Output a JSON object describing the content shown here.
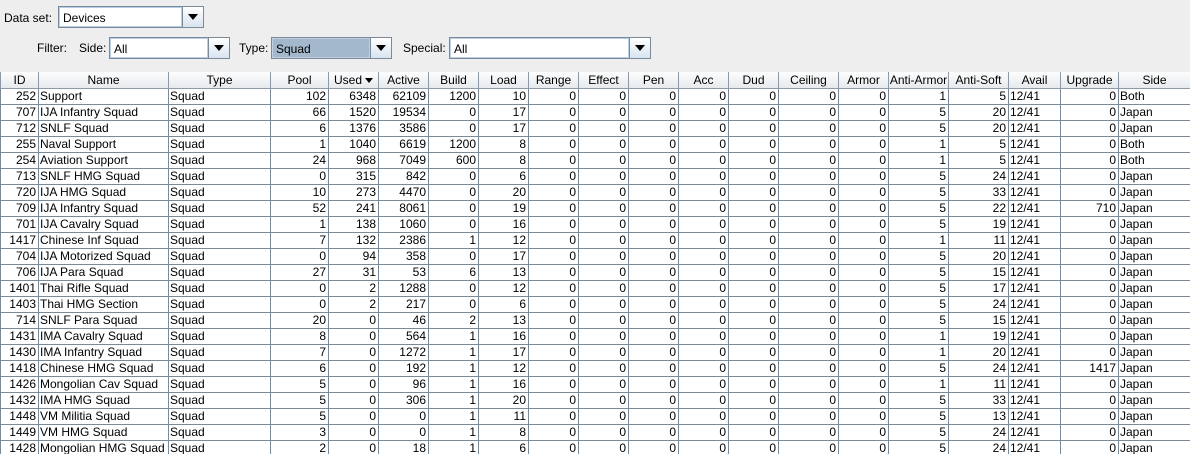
{
  "toolbar": {
    "dataset_label": "Data set:",
    "dataset_value": "Devices",
    "filter_label": "Filter:",
    "side_label": "Side:",
    "side_value": "All",
    "type_label": "Type:",
    "type_value": "Squad",
    "special_label": "Special:",
    "special_value": "All"
  },
  "table": {
    "sorted_column": "Used",
    "columns": [
      "ID",
      "Name",
      "Type",
      "Pool",
      "Used",
      "Active",
      "Build",
      "Load",
      "Range",
      "Effect",
      "Pen",
      "Acc",
      "Dud",
      "Ceiling",
      "Armor",
      "Anti-Armor",
      "Anti-Soft",
      "Avail",
      "Upgrade",
      "Side"
    ],
    "rows": [
      [
        "252",
        "Support",
        "Squad",
        "102",
        "6348",
        "62109",
        "1200",
        "10",
        "0",
        "0",
        "0",
        "0",
        "0",
        "0",
        "0",
        "1",
        "5",
        "12/41",
        "0",
        "Both"
      ],
      [
        "707",
        "IJA Infantry Squad",
        "Squad",
        "66",
        "1520",
        "19534",
        "0",
        "17",
        "0",
        "0",
        "0",
        "0",
        "0",
        "0",
        "0",
        "5",
        "20",
        "12/41",
        "0",
        "Japan"
      ],
      [
        "712",
        "SNLF Squad",
        "Squad",
        "6",
        "1376",
        "3586",
        "0",
        "17",
        "0",
        "0",
        "0",
        "0",
        "0",
        "0",
        "0",
        "5",
        "20",
        "12/41",
        "0",
        "Japan"
      ],
      [
        "255",
        "Naval Support",
        "Squad",
        "1",
        "1040",
        "6619",
        "1200",
        "8",
        "0",
        "0",
        "0",
        "0",
        "0",
        "0",
        "0",
        "1",
        "5",
        "12/41",
        "0",
        "Both"
      ],
      [
        "254",
        "Aviation Support",
        "Squad",
        "24",
        "968",
        "7049",
        "600",
        "8",
        "0",
        "0",
        "0",
        "0",
        "0",
        "0",
        "0",
        "1",
        "5",
        "12/41",
        "0",
        "Both"
      ],
      [
        "713",
        "SNLF HMG Squad",
        "Squad",
        "0",
        "315",
        "842",
        "0",
        "6",
        "0",
        "0",
        "0",
        "0",
        "0",
        "0",
        "0",
        "5",
        "24",
        "12/41",
        "0",
        "Japan"
      ],
      [
        "720",
        "IJA HMG Squad",
        "Squad",
        "10",
        "273",
        "4470",
        "0",
        "20",
        "0",
        "0",
        "0",
        "0",
        "0",
        "0",
        "0",
        "5",
        "33",
        "12/41",
        "0",
        "Japan"
      ],
      [
        "709",
        "IJA Infantry Squad",
        "Squad",
        "52",
        "241",
        "8061",
        "0",
        "19",
        "0",
        "0",
        "0",
        "0",
        "0",
        "0",
        "0",
        "5",
        "22",
        "12/41",
        "710",
        "Japan"
      ],
      [
        "701",
        "IJA Cavalry Squad",
        "Squad",
        "1",
        "138",
        "1060",
        "0",
        "16",
        "0",
        "0",
        "0",
        "0",
        "0",
        "0",
        "0",
        "5",
        "19",
        "12/41",
        "0",
        "Japan"
      ],
      [
        "1417",
        "Chinese Inf Squad",
        "Squad",
        "7",
        "132",
        "2386",
        "1",
        "12",
        "0",
        "0",
        "0",
        "0",
        "0",
        "0",
        "0",
        "1",
        "11",
        "12/41",
        "0",
        "Japan"
      ],
      [
        "704",
        "IJA Motorized Squad",
        "Squad",
        "0",
        "94",
        "358",
        "0",
        "17",
        "0",
        "0",
        "0",
        "0",
        "0",
        "0",
        "0",
        "5",
        "20",
        "12/41",
        "0",
        "Japan"
      ],
      [
        "706",
        "IJA Para Squad",
        "Squad",
        "27",
        "31",
        "53",
        "6",
        "13",
        "0",
        "0",
        "0",
        "0",
        "0",
        "0",
        "0",
        "5",
        "15",
        "12/41",
        "0",
        "Japan"
      ],
      [
        "1401",
        "Thai Rifle Squad",
        "Squad",
        "0",
        "2",
        "1288",
        "0",
        "12",
        "0",
        "0",
        "0",
        "0",
        "0",
        "0",
        "0",
        "5",
        "17",
        "12/41",
        "0",
        "Japan"
      ],
      [
        "1403",
        "Thai HMG Section",
        "Squad",
        "0",
        "2",
        "217",
        "0",
        "6",
        "0",
        "0",
        "0",
        "0",
        "0",
        "0",
        "0",
        "5",
        "24",
        "12/41",
        "0",
        "Japan"
      ],
      [
        "714",
        "SNLF Para Squad",
        "Squad",
        "20",
        "0",
        "46",
        "2",
        "13",
        "0",
        "0",
        "0",
        "0",
        "0",
        "0",
        "0",
        "5",
        "15",
        "12/41",
        "0",
        "Japan"
      ],
      [
        "1431",
        "IMA Cavalry Squad",
        "Squad",
        "8",
        "0",
        "564",
        "1",
        "16",
        "0",
        "0",
        "0",
        "0",
        "0",
        "0",
        "0",
        "1",
        "19",
        "12/41",
        "0",
        "Japan"
      ],
      [
        "1430",
        "IMA Infantry Squad",
        "Squad",
        "7",
        "0",
        "1272",
        "1",
        "17",
        "0",
        "0",
        "0",
        "0",
        "0",
        "0",
        "0",
        "1",
        "20",
        "12/41",
        "0",
        "Japan"
      ],
      [
        "1418",
        "Chinese HMG Squad",
        "Squad",
        "6",
        "0",
        "192",
        "1",
        "12",
        "0",
        "0",
        "0",
        "0",
        "0",
        "0",
        "0",
        "5",
        "24",
        "12/41",
        "1417",
        "Japan"
      ],
      [
        "1426",
        "Mongolian Cav Squad",
        "Squad",
        "5",
        "0",
        "96",
        "1",
        "16",
        "0",
        "0",
        "0",
        "0",
        "0",
        "0",
        "0",
        "1",
        "11",
        "12/41",
        "0",
        "Japan"
      ],
      [
        "1432",
        "IMA HMG Squad",
        "Squad",
        "5",
        "0",
        "306",
        "1",
        "20",
        "0",
        "0",
        "0",
        "0",
        "0",
        "0",
        "0",
        "5",
        "33",
        "12/41",
        "0",
        "Japan"
      ],
      [
        "1448",
        "VM Militia Squad",
        "Squad",
        "5",
        "0",
        "0",
        "1",
        "11",
        "0",
        "0",
        "0",
        "0",
        "0",
        "0",
        "0",
        "5",
        "13",
        "12/41",
        "0",
        "Japan"
      ],
      [
        "1449",
        "VM HMG Squad",
        "Squad",
        "3",
        "0",
        "0",
        "1",
        "8",
        "0",
        "0",
        "0",
        "0",
        "0",
        "0",
        "0",
        "5",
        "24",
        "12/41",
        "0",
        "Japan"
      ],
      [
        "1428",
        "Mongolian HMG Squad",
        "Squad",
        "2",
        "0",
        "18",
        "1",
        "6",
        "0",
        "0",
        "0",
        "0",
        "0",
        "0",
        "0",
        "5",
        "24",
        "12/41",
        "0",
        "Japan"
      ]
    ]
  }
}
